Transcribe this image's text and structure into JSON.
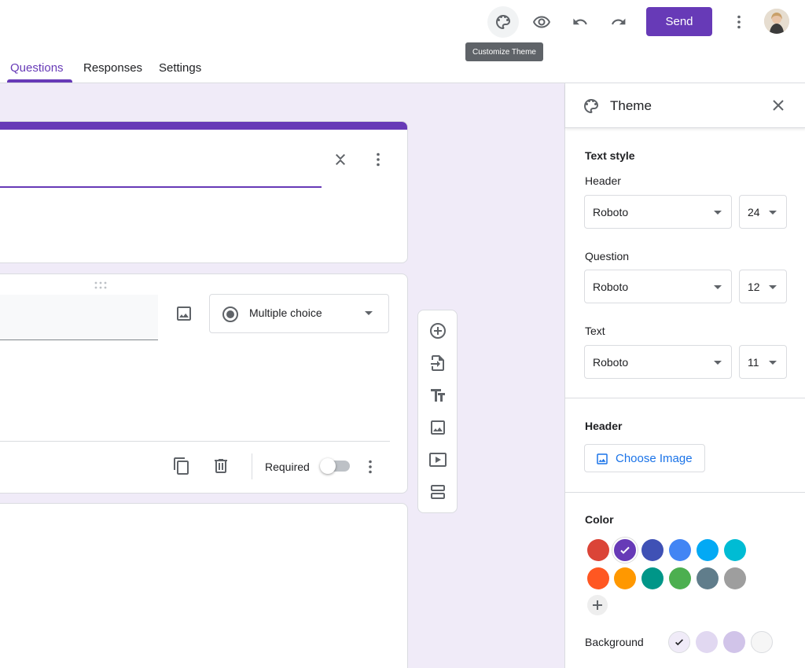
{
  "topbar": {
    "send_label": "Send",
    "tooltip": "Customize Theme",
    "tabs": [
      "Questions",
      "Responses",
      "Settings"
    ],
    "icons": [
      "palette-icon",
      "eye-icon",
      "undo-icon",
      "redo-icon",
      "more-vert-icon"
    ]
  },
  "question": {
    "type_label": "Multiple choice",
    "required_label": "Required",
    "required_on": false
  },
  "theme": {
    "title": "Theme",
    "text_style_title": "Text style",
    "header": {
      "label": "Header",
      "font": "Roboto",
      "size": "24"
    },
    "question": {
      "label": "Question",
      "font": "Roboto",
      "size": "12"
    },
    "text": {
      "label": "Text",
      "font": "Roboto",
      "size": "11"
    },
    "header_section_title": "Header",
    "choose_image": "Choose Image",
    "color_title": "Color",
    "colors": [
      "#db4437",
      "#673ab7",
      "#3f51b5",
      "#4285f4",
      "#03a9f4",
      "#00bcd4",
      "#ff5722",
      "#ff9800",
      "#009688",
      "#4caf50",
      "#607d8b",
      "#9e9e9e"
    ],
    "selected_color": "#673ab7",
    "background_label": "Background",
    "background_colors": [
      "#f0ebf8",
      "#e1d8f1",
      "#d1c4e9",
      "#f6f6f6"
    ],
    "selected_background": "#f0ebf8"
  },
  "accent_color": "#673ab7"
}
